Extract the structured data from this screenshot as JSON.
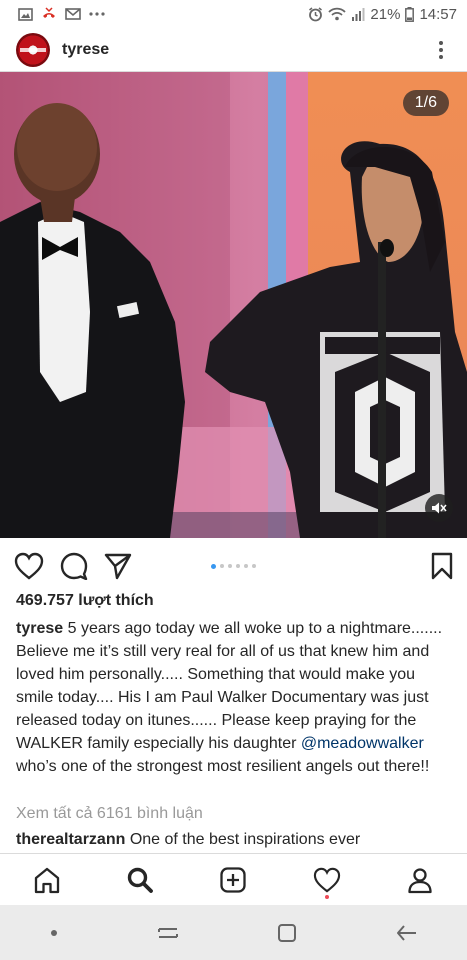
{
  "status_bar": {
    "battery": "21%",
    "time": "14:57",
    "icons": [
      "gallery-icon",
      "missed-call-icon",
      "mail-icon",
      "more-notifications-icon",
      "alarm-icon",
      "wifi-icon",
      "signal-icon",
      "battery-icon"
    ]
  },
  "post": {
    "username": "tyrese",
    "media_counter": "1/6",
    "carousel": {
      "total": 6,
      "active": 0
    },
    "likes": "469.757 lượt thích",
    "caption": {
      "username": "tyrese",
      "text_before": " 5 years ago today we all woke up to a nightmare....... Believe me it’s still very real for all of us that knew him and loved him personally..... Something that would make you smile today.... His I am Paul Walker Documentary was just released today on itunes...... Please keep praying for the WALKER family especially his daughter ",
      "mention": "@meadowwalker",
      "text_after": " who’s one of the strongest most resilient angels out there!!"
    },
    "view_comments": "Xem tất cả 6161 bình luận",
    "comment": {
      "username": "therealtarzann",
      "text": " One of the best inspirations ever"
    }
  },
  "colors": {
    "accent_link": "#3897f0",
    "mention": "#003569",
    "notification": "#ed4956",
    "muted_text": "#999999"
  },
  "nav": [
    "home-icon",
    "search-icon",
    "new-post-icon",
    "activity-icon",
    "profile-icon"
  ],
  "android_nav": [
    "dot-icon",
    "recent-apps-icon",
    "home-square-icon",
    "back-icon"
  ]
}
